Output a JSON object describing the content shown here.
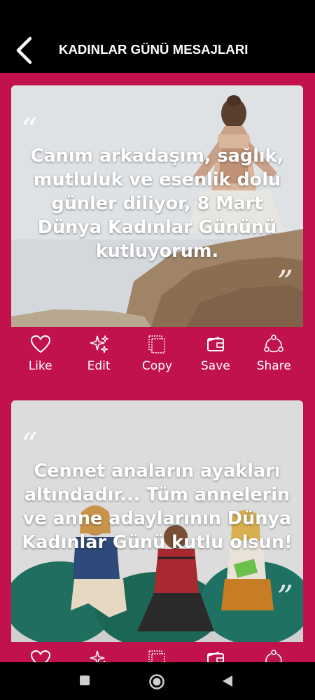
{
  "header": {
    "title": "KADINLAR GÜNÜ MESAJLARI",
    "back_icon": "chevron-left-icon"
  },
  "colors": {
    "accent": "#c2124d",
    "header_bg": "#000000",
    "text": "#ffffff"
  },
  "actions": [
    {
      "label": "Like",
      "icon": "heart-icon"
    },
    {
      "label": "Edit",
      "icon": "sparkles-icon"
    },
    {
      "label": "Copy",
      "icon": "copy-icon"
    },
    {
      "label": "Save",
      "icon": "wallet-icon"
    },
    {
      "label": "Share",
      "icon": "share-icon"
    }
  ],
  "cards": [
    {
      "text": "Canım arkadaşım, sağlık, mutluluk ve esenlik dolu günler diliyor, 8 Mart Dünya Kadınlar Gününü kutluyorum.",
      "open_quote": "“",
      "close_quote": "”"
    },
    {
      "text": "Cennet anaların ayakları altındadır... Tüm annelerin ve anne adaylarının Dünya Kadınlar Günü kutlu olsun!",
      "open_quote": "“",
      "close_quote": "”"
    }
  ],
  "system_nav": {
    "recents_icon": "square-icon",
    "home_icon": "circle-icon",
    "back_icon": "triangle-back-icon"
  }
}
